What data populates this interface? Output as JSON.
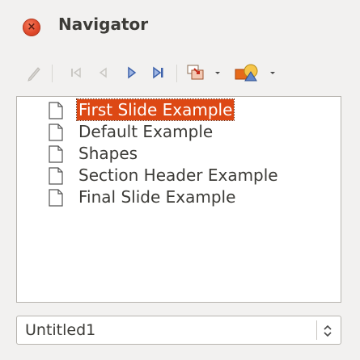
{
  "window": {
    "title": "Navigator"
  },
  "toolbar": {
    "icons": [
      "pencil-icon",
      "first-slide-icon",
      "previous-slide-icon",
      "next-slide-icon",
      "last-slide-icon",
      "drag-mode-icon",
      "dropdown-arrow-icon",
      "shapes-icon",
      "dropdown-arrow-icon"
    ]
  },
  "slides": [
    {
      "label": "First Slide Example",
      "selected": true
    },
    {
      "label": "Default Example",
      "selected": false
    },
    {
      "label": "Shapes",
      "selected": false
    },
    {
      "label": "Section Header Example",
      "selected": false
    },
    {
      "label": "Final Slide Example",
      "selected": false
    }
  ],
  "document_select": {
    "value": "Untitled1"
  },
  "colors": {
    "selection": "#dd4814",
    "close": "#e0482a",
    "nav_arrow": "#4a6fb4"
  }
}
